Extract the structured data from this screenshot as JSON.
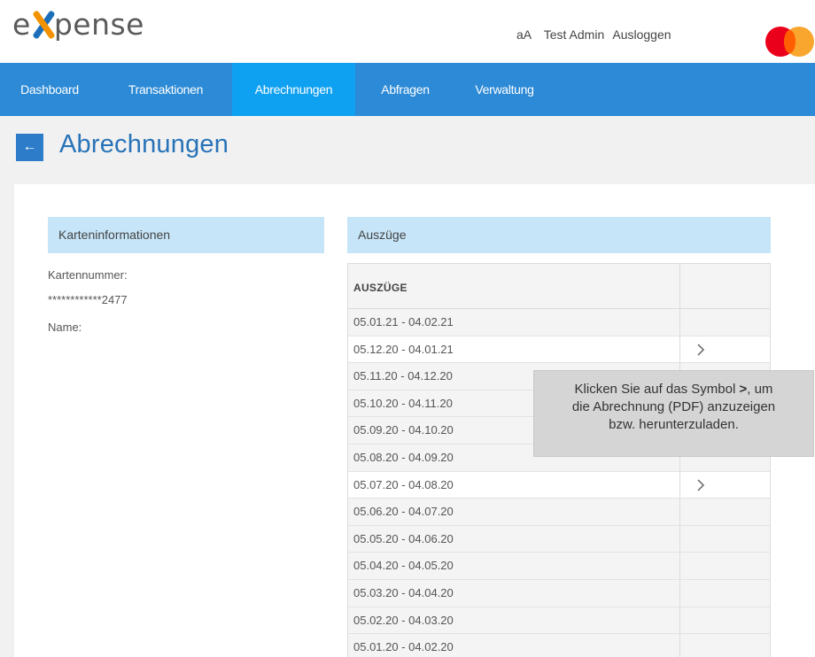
{
  "app": {
    "logo_first": "e",
    "logo_rest": "pense"
  },
  "header": {
    "font_size_toggle": "aA",
    "user_name": "Test Admin",
    "logout": "Ausloggen"
  },
  "nav": {
    "items": [
      {
        "label": "Dashboard",
        "active": false
      },
      {
        "label": "Transaktionen",
        "active": false
      },
      {
        "label": "Abrechnungen",
        "active": true
      },
      {
        "label": "Abfragen",
        "active": false
      },
      {
        "label": "Verwaltung",
        "active": false
      }
    ]
  },
  "page": {
    "back_icon": "arrow-left-icon",
    "title": "Abrechnungen"
  },
  "card_info": {
    "heading": "Karteninformationen",
    "card_number_label": "Kartennummer:",
    "card_number_value": "************2477",
    "name_label": "Name:"
  },
  "statements": {
    "heading": "Auszüge",
    "column_header": "AUSZÜGE",
    "rows": [
      {
        "period": "05.01.21 - 04.02.21",
        "pdf": false
      },
      {
        "period": "05.12.20 - 04.01.21",
        "pdf": true
      },
      {
        "period": "05.11.20 - 04.12.20",
        "pdf": false
      },
      {
        "period": "05.10.20 - 04.11.20",
        "pdf": false
      },
      {
        "period": "05.09.20 - 04.10.20",
        "pdf": false
      },
      {
        "period": "05.08.20 - 04.09.20",
        "pdf": false
      },
      {
        "period": "05.07.20 - 04.08.20",
        "pdf": true
      },
      {
        "period": "05.06.20 - 04.07.20",
        "pdf": false
      },
      {
        "period": "05.05.20 - 04.06.20",
        "pdf": false
      },
      {
        "period": "05.04.20 - 04.05.20",
        "pdf": false
      },
      {
        "period": "05.03.20 - 04.04.20",
        "pdf": false
      },
      {
        "period": "05.02.20 - 04.03.20",
        "pdf": false
      },
      {
        "period": "05.01.20 - 04.02.20",
        "pdf": false
      }
    ]
  },
  "tooltip": {
    "line1_prefix": "Klicken Sie auf das Symbol ",
    "line1_symbol": ">",
    "line1_suffix": ", um",
    "line2": "die Abrechnung (PDF) anzuzeigen",
    "line3": "bzw. herunterzuladen."
  },
  "colors": {
    "nav_bg": "#2c8ad6",
    "nav_active": "#0fa1f1",
    "title": "#2873b8",
    "section_head": "#c6e5f8",
    "logo_blue": "#1b6fb9",
    "logo_orange": "#f39200"
  }
}
